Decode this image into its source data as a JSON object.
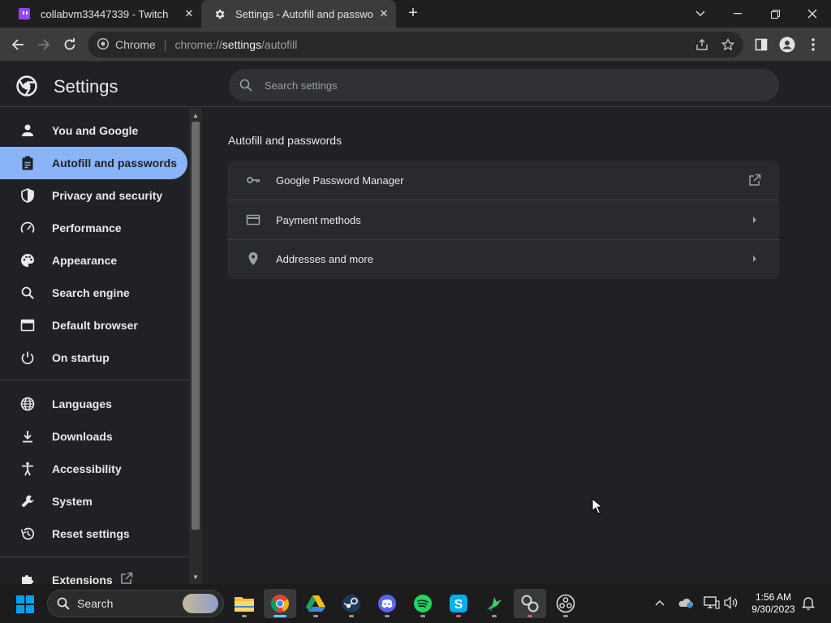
{
  "browser": {
    "tabs": [
      {
        "title": "collabvm33447339 - Twitch",
        "active": false
      },
      {
        "title": "Settings - Autofill and passwords",
        "active": true
      }
    ],
    "omnibox": {
      "chip_label": "Chrome",
      "url_scheme": "chrome://",
      "url_host": "settings",
      "url_path": "/autofill"
    }
  },
  "settings": {
    "title": "Settings",
    "search_placeholder": "Search settings",
    "nav_items": [
      {
        "label": "You and Google",
        "icon": "person-icon"
      },
      {
        "label": "Autofill and passwords",
        "icon": "clipboard-icon",
        "selected": true
      },
      {
        "label": "Privacy and security",
        "icon": "shield-icon"
      },
      {
        "label": "Performance",
        "icon": "speedometer-icon"
      },
      {
        "label": "Appearance",
        "icon": "palette-icon"
      },
      {
        "label": "Search engine",
        "icon": "search-icon"
      },
      {
        "label": "Default browser",
        "icon": "browser-window-icon"
      },
      {
        "label": "On startup",
        "icon": "power-icon"
      },
      {
        "label": "Languages",
        "icon": "globe-icon"
      },
      {
        "label": "Downloads",
        "icon": "download-icon"
      },
      {
        "label": "Accessibility",
        "icon": "accessibility-icon"
      },
      {
        "label": "System",
        "icon": "wrench-icon"
      },
      {
        "label": "Reset settings",
        "icon": "history-icon"
      },
      {
        "label": "Extensions",
        "icon": "puzzle-icon"
      }
    ],
    "section_title": "Autofill and passwords",
    "rows": [
      {
        "label": "Google Password Manager",
        "icon": "key-icon",
        "action": "open-in-new-icon"
      },
      {
        "label": "Payment methods",
        "icon": "credit-card-icon",
        "action": "arrow-right-icon"
      },
      {
        "label": "Addresses and more",
        "icon": "location-pin-icon",
        "action": "arrow-right-icon"
      }
    ]
  },
  "taskbar": {
    "search_label": "Search",
    "apps": [
      "file-explorer-icon",
      "chrome-icon",
      "google-drive-icon",
      "steam-icon",
      "discord-icon",
      "spotify-icon",
      "skype-icon",
      "hummingbird-app-icon",
      "obs-related-icon",
      "obs-icon"
    ],
    "time": "1:56 AM",
    "date": "9/30/2023"
  },
  "colors": {
    "accent": "#8ab4f8",
    "background": "#202124",
    "card": "#292a2d",
    "tabstrip": "#1f1f1f",
    "toolbar": "#3c3c3c"
  }
}
